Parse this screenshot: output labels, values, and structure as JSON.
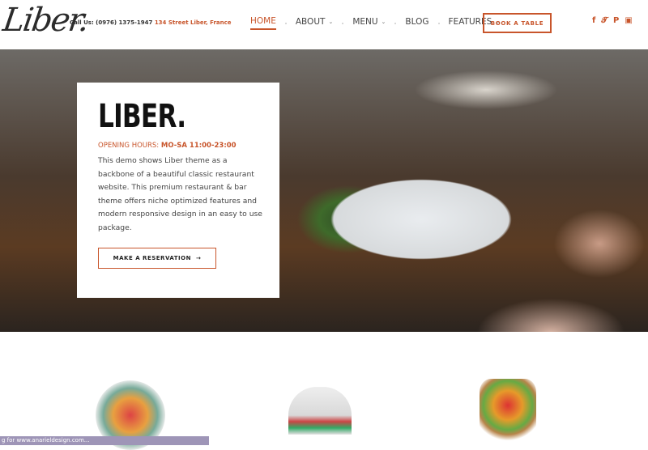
{
  "header": {
    "logo": "Liber.",
    "call_label": "Call Us: (0976) 1375-1947",
    "address": "134 Street Liber, France",
    "nav": [
      {
        "label": "HOME",
        "active": true,
        "dropdown": false
      },
      {
        "label": "ABOUT",
        "dropdown": true
      },
      {
        "label": "MENU",
        "dropdown": true
      },
      {
        "label": "BLOG",
        "dropdown": false
      },
      {
        "label": "FEATURES",
        "dropdown": true
      }
    ],
    "book_label": "BOOK A TABLE",
    "social": [
      "facebook-icon",
      "twitter-icon",
      "pinterest-icon",
      "instagram-icon"
    ],
    "accent": "#c8552b"
  },
  "hero": {
    "title": "LIBER.",
    "hours_label": "OPENING HOURS:",
    "hours_value": "MO-SA 11:00-23:00",
    "description": "This demo shows Liber theme as a backbone of a beautiful classic restaurant website. This premium restaurant & bar theme offers niche optimized features and modern responsive design in an easy to use package.",
    "button_label": "MAKE A RESERVATION",
    "button_icon": "arrow-right-icon"
  },
  "status_bar": "g for www.anarieldesign.com..."
}
